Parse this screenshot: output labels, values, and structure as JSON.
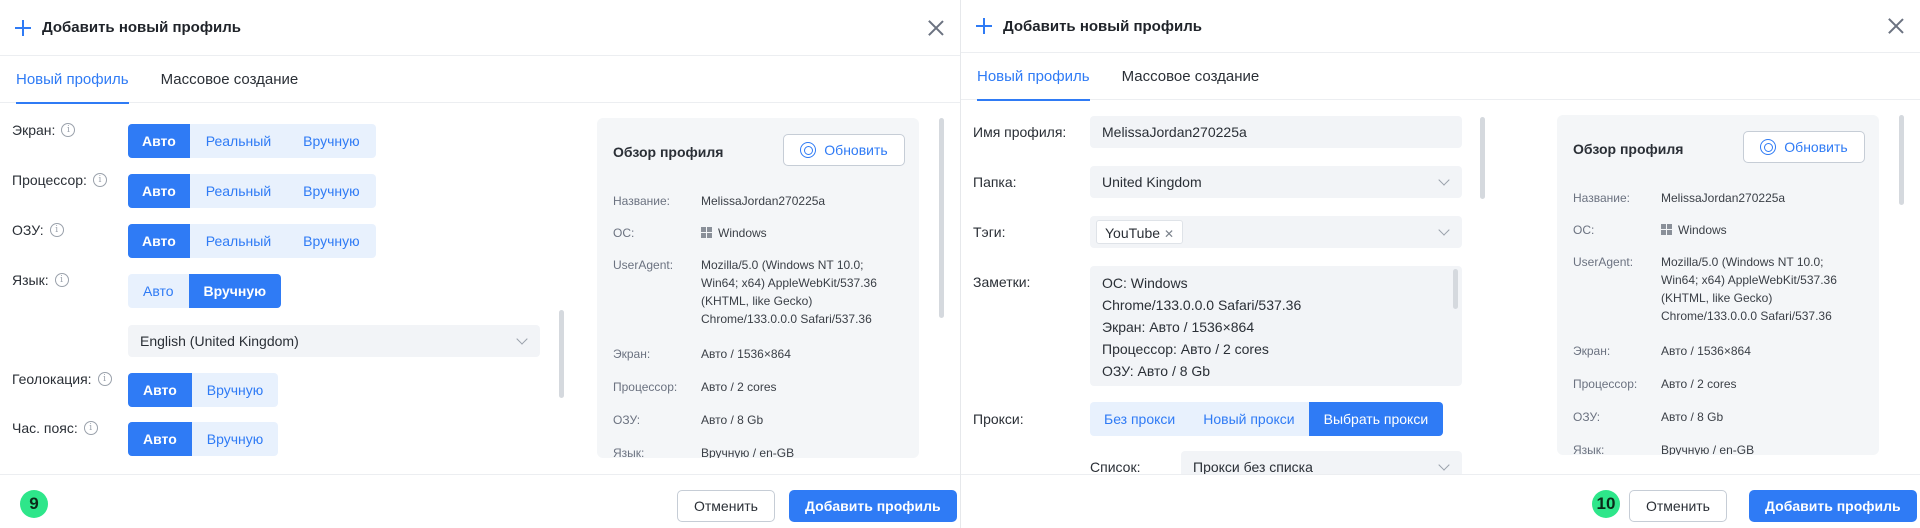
{
  "left": {
    "badge": "9",
    "header": {
      "title": "Добавить новый профиль"
    },
    "tabs": [
      "Новый профиль",
      "Массовое создание"
    ],
    "rows": [
      {
        "label": "Экран:",
        "options": [
          "Авто",
          "Реальный",
          "Вручную"
        ],
        "selected": 0
      },
      {
        "label": "Процессор:",
        "options": [
          "Авто",
          "Реальный",
          "Вручную"
        ],
        "selected": 0
      },
      {
        "label": "ОЗУ:",
        "options": [
          "Авто",
          "Реальный",
          "Вручную"
        ],
        "selected": 0
      },
      {
        "label": "Язык:",
        "options": [
          "Авто",
          "Вручную"
        ],
        "selected": 1
      },
      {
        "label": "Геолокация:",
        "options": [
          "Авто",
          "Вручную"
        ],
        "selected": 0
      },
      {
        "label": "Час. пояс:",
        "options": [
          "Авто",
          "Вручную"
        ],
        "selected": 0
      }
    ],
    "language_select": "English (United Kingdom)",
    "overview": {
      "title": "Обзор профиля",
      "refresh": "Обновить",
      "items": [
        {
          "k": "Название:",
          "v": "MelissaJordan270225a"
        },
        {
          "k": "ОС:",
          "v": "Windows"
        },
        {
          "k": "UserAgent:",
          "v": "Mozilla/5.0 (Windows NT 10.0; Win64; x64) AppleWebKit/537.36 (KHTML, like Gecko) Chrome/133.0.0.0 Safari/537.36"
        },
        {
          "k": "Экран:",
          "v": "Авто / 1536×864"
        },
        {
          "k": "Процессор:",
          "v": "Авто / 2 cores"
        },
        {
          "k": "ОЗУ:",
          "v": "Авто / 8 Gb"
        },
        {
          "k": "Язык:",
          "v": "Вручную / en-GB"
        }
      ]
    },
    "footer": {
      "cancel": "Отменить",
      "add": "Добавить профиль"
    }
  },
  "right": {
    "badge": "10",
    "header": {
      "title": "Добавить новый профиль"
    },
    "tabs": [
      "Новый профиль",
      "Массовое создание"
    ],
    "name_label": "Имя профиля:",
    "name_value": "MelissaJordan270225a",
    "folder_label": "Папка:",
    "folder_value": "United Kingdom",
    "tags_label": "Тэги:",
    "tag": "YouTube",
    "notes_label": "Заметки:",
    "notes": [
      "ОС: Windows",
      "Chrome/133.0.0.0 Safari/537.36",
      "Экран: Авто / 1536×864",
      "Процессор: Авто / 2 cores",
      "ОЗУ: Авто / 8 Gb"
    ],
    "proxy_label": "Прокси:",
    "proxy_options": [
      "Без прокси",
      "Новый прокси",
      "Выбрать прокси"
    ],
    "proxy_selected": 2,
    "list_label": "Список:",
    "list_value": "Прокси без списка",
    "overview": {
      "title": "Обзор профиля",
      "refresh": "Обновить",
      "items": [
        {
          "k": "Название:",
          "v": "MelissaJordan270225a"
        },
        {
          "k": "ОС:",
          "v": "Windows"
        },
        {
          "k": "UserAgent:",
          "v": "Mozilla/5.0 (Windows NT 10.0; Win64; x64) AppleWebKit/537.36 (KHTML, like Gecko) Chrome/133.0.0.0 Safari/537.36"
        },
        {
          "k": "Экран:",
          "v": "Авто / 1536×864"
        },
        {
          "k": "Процессор:",
          "v": "Авто / 2 cores"
        },
        {
          "k": "ОЗУ:",
          "v": "Авто / 8 Gb"
        },
        {
          "k": "Язык:",
          "v": "Вручную / en-GB"
        }
      ]
    },
    "footer": {
      "cancel": "Отменить",
      "add": "Добавить профиль"
    }
  }
}
